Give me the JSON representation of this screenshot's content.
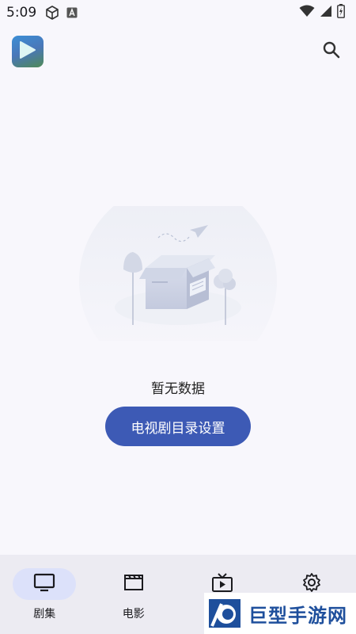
{
  "status_bar": {
    "time": "5:09",
    "icons_left": [
      "cube-icon",
      "app-notification-icon"
    ],
    "icons_right": [
      "wifi-icon",
      "signal-icon",
      "battery-icon"
    ]
  },
  "app_bar": {
    "logo_icon": "play-icon",
    "search_icon": "search-icon"
  },
  "empty_state": {
    "message": "暂无数据",
    "button_label": "电视剧目录设置"
  },
  "bottom_nav": {
    "items": [
      {
        "label": "剧集",
        "icon": "tv-icon",
        "active": true
      },
      {
        "label": "电影",
        "icon": "clapperboard-icon",
        "active": false
      },
      {
        "label": "",
        "icon": "live-tv-icon",
        "active": false
      },
      {
        "label": "",
        "icon": "settings-icon",
        "active": false
      }
    ]
  },
  "watermark": {
    "text": "巨型手游网"
  },
  "colors": {
    "background": "#f8f7fc",
    "primary": "#3d5ab5",
    "nav_background": "#ecebf2",
    "nav_active_pill": "#dce1fa"
  }
}
